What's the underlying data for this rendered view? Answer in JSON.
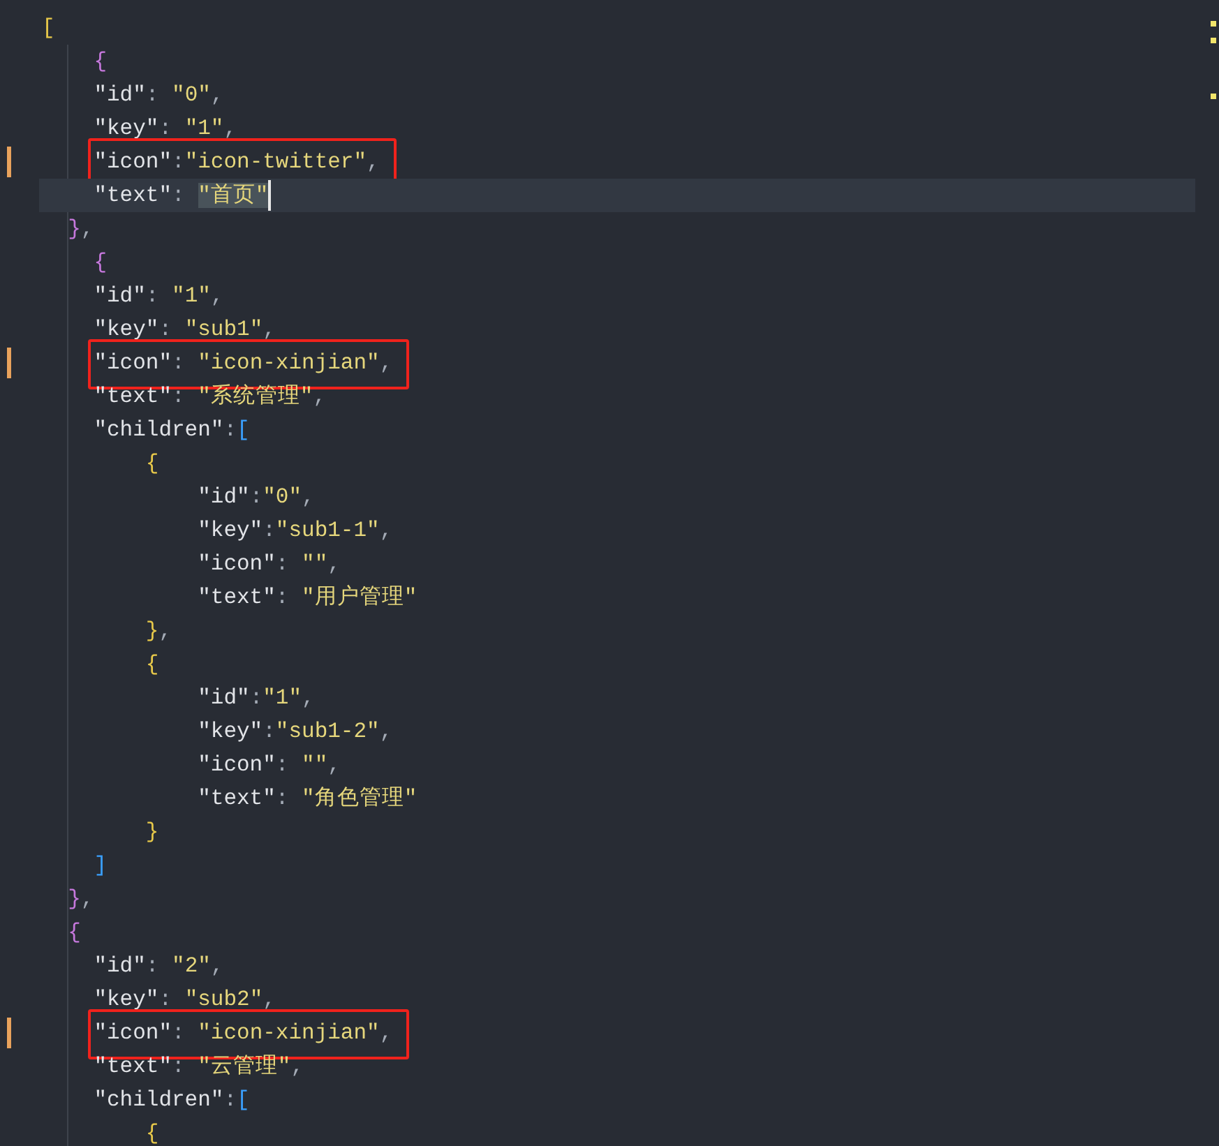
{
  "editor": {
    "lines": [
      {
        "kind": "flush",
        "tokens": [
          {
            "text": "[",
            "kind": "bracket",
            "color": "#e8c94a"
          }
        ]
      },
      {
        "kind": "base",
        "tokens": [
          {
            "text": "{",
            "kind": "bracket",
            "color": "#c678dd"
          }
        ]
      },
      {
        "kind": "base",
        "tokens": [
          {
            "text": "\"id\"",
            "kind": "key"
          },
          {
            "text": ": ",
            "kind": "punct"
          },
          {
            "text": "\"0\"",
            "kind": "string"
          },
          {
            "text": ",",
            "kind": "punct"
          }
        ]
      },
      {
        "kind": "base",
        "tokens": [
          {
            "text": "\"key\"",
            "kind": "key"
          },
          {
            "text": ": ",
            "kind": "punct"
          },
          {
            "text": "\"1\"",
            "kind": "string"
          },
          {
            "text": ",",
            "kind": "punct"
          }
        ]
      },
      {
        "kind": "base",
        "modified": true,
        "annotated": true,
        "tokens": [
          {
            "text": "\"icon\"",
            "kind": "key"
          },
          {
            "text": ":",
            "kind": "punct"
          },
          {
            "text": "\"icon-twitter\"",
            "kind": "string"
          },
          {
            "text": ",",
            "kind": "punct"
          }
        ]
      },
      {
        "kind": "base",
        "current": true,
        "cursor": true,
        "tokens": [
          {
            "text": "\"text\"",
            "kind": "key"
          },
          {
            "text": ": ",
            "kind": "punct"
          },
          {
            "text": "\"首页\"",
            "kind": "string",
            "highlighted": true
          }
        ]
      },
      {
        "kind": "shallow",
        "tokens": [
          {
            "text": "}",
            "kind": "bracket",
            "color": "#c678dd"
          },
          {
            "text": ",",
            "kind": "punct"
          }
        ]
      },
      {
        "kind": "base",
        "tokens": [
          {
            "text": "{",
            "kind": "bracket",
            "color": "#c678dd"
          }
        ]
      },
      {
        "kind": "base",
        "tokens": [
          {
            "text": "\"id\"",
            "kind": "key"
          },
          {
            "text": ": ",
            "kind": "punct"
          },
          {
            "text": "\"1\"",
            "kind": "string"
          },
          {
            "text": ",",
            "kind": "punct"
          }
        ]
      },
      {
        "kind": "base",
        "tokens": [
          {
            "text": "\"key\"",
            "kind": "key"
          },
          {
            "text": ": ",
            "kind": "punct"
          },
          {
            "text": "\"sub1\"",
            "kind": "string"
          },
          {
            "text": ",",
            "kind": "punct"
          }
        ]
      },
      {
        "kind": "base",
        "modified": true,
        "annotated": true,
        "tokens": [
          {
            "text": "\"icon\"",
            "kind": "key"
          },
          {
            "text": ": ",
            "kind": "punct"
          },
          {
            "text": "\"icon-xinjian\"",
            "kind": "string"
          },
          {
            "text": ",",
            "kind": "punct"
          }
        ]
      },
      {
        "kind": "base",
        "tokens": [
          {
            "text": "\"text\"",
            "kind": "key"
          },
          {
            "text": ": ",
            "kind": "punct"
          },
          {
            "text": "\"系统管理\"",
            "kind": "string"
          },
          {
            "text": ",",
            "kind": "punct"
          }
        ]
      },
      {
        "kind": "base",
        "tokens": [
          {
            "text": "\"children\"",
            "kind": "key"
          },
          {
            "text": ":",
            "kind": "punct"
          },
          {
            "text": "[",
            "kind": "bracket",
            "color": "#3aa0ff"
          }
        ]
      },
      {
        "kind": "nested",
        "tokens": [
          {
            "text": "{",
            "kind": "bracket",
            "color": "#e8c94a"
          }
        ]
      },
      {
        "kind": "deep",
        "tokens": [
          {
            "text": "\"id\"",
            "kind": "key"
          },
          {
            "text": ":",
            "kind": "punct"
          },
          {
            "text": "\"0\"",
            "kind": "string"
          },
          {
            "text": ",",
            "kind": "punct"
          }
        ]
      },
      {
        "kind": "deep",
        "tokens": [
          {
            "text": "\"key\"",
            "kind": "key"
          },
          {
            "text": ":",
            "kind": "punct"
          },
          {
            "text": "\"sub1-1\"",
            "kind": "string"
          },
          {
            "text": ",",
            "kind": "punct"
          }
        ]
      },
      {
        "kind": "deep",
        "tokens": [
          {
            "text": "\"icon\"",
            "kind": "key"
          },
          {
            "text": ": ",
            "kind": "punct"
          },
          {
            "text": "\"\"",
            "kind": "string"
          },
          {
            "text": ",",
            "kind": "punct"
          }
        ]
      },
      {
        "kind": "deep",
        "tokens": [
          {
            "text": "\"text\"",
            "kind": "key"
          },
          {
            "text": ": ",
            "kind": "punct"
          },
          {
            "text": "\"用户管理\"",
            "kind": "string"
          }
        ]
      },
      {
        "kind": "nested",
        "tokens": [
          {
            "text": "}",
            "kind": "bracket",
            "color": "#e8c94a"
          },
          {
            "text": ",",
            "kind": "punct"
          }
        ]
      },
      {
        "kind": "nested",
        "tokens": [
          {
            "text": "{",
            "kind": "bracket",
            "color": "#e8c94a"
          }
        ]
      },
      {
        "kind": "deep",
        "tokens": [
          {
            "text": "\"id\"",
            "kind": "key"
          },
          {
            "text": ":",
            "kind": "punct"
          },
          {
            "text": "\"1\"",
            "kind": "string"
          },
          {
            "text": ",",
            "kind": "punct"
          }
        ]
      },
      {
        "kind": "deep",
        "tokens": [
          {
            "text": "\"key\"",
            "kind": "key"
          },
          {
            "text": ":",
            "kind": "punct"
          },
          {
            "text": "\"sub1-2\"",
            "kind": "string"
          },
          {
            "text": ",",
            "kind": "punct"
          }
        ]
      },
      {
        "kind": "deep",
        "tokens": [
          {
            "text": "\"icon\"",
            "kind": "key"
          },
          {
            "text": ": ",
            "kind": "punct"
          },
          {
            "text": "\"\"",
            "kind": "string"
          },
          {
            "text": ",",
            "kind": "punct"
          }
        ]
      },
      {
        "kind": "deep",
        "tokens": [
          {
            "text": "\"text\"",
            "kind": "key"
          },
          {
            "text": ": ",
            "kind": "punct"
          },
          {
            "text": "\"角色管理\"",
            "kind": "string"
          }
        ]
      },
      {
        "kind": "nested",
        "tokens": [
          {
            "text": "}",
            "kind": "bracket",
            "color": "#e8c94a"
          }
        ]
      },
      {
        "kind": "base",
        "tokens": [
          {
            "text": "]",
            "kind": "bracket",
            "color": "#3aa0ff"
          }
        ]
      },
      {
        "kind": "shallow",
        "tokens": [
          {
            "text": "}",
            "kind": "bracket",
            "color": "#c678dd"
          },
          {
            "text": ",",
            "kind": "punct"
          }
        ]
      },
      {
        "kind": "shallow",
        "tokens": [
          {
            "text": "{",
            "kind": "bracket",
            "color": "#c678dd"
          }
        ]
      },
      {
        "kind": "base",
        "tokens": [
          {
            "text": "\"id\"",
            "kind": "key"
          },
          {
            "text": ": ",
            "kind": "punct"
          },
          {
            "text": "\"2\"",
            "kind": "string"
          },
          {
            "text": ",",
            "kind": "punct"
          }
        ]
      },
      {
        "kind": "base",
        "tokens": [
          {
            "text": "\"key\"",
            "kind": "key"
          },
          {
            "text": ": ",
            "kind": "punct"
          },
          {
            "text": "\"sub2\"",
            "kind": "string"
          },
          {
            "text": ",",
            "kind": "punct"
          }
        ]
      },
      {
        "kind": "base",
        "modified": true,
        "annotated": true,
        "tokens": [
          {
            "text": "\"icon\"",
            "kind": "key"
          },
          {
            "text": ": ",
            "kind": "punct"
          },
          {
            "text": "\"icon-xinjian\"",
            "kind": "string"
          },
          {
            "text": ",",
            "kind": "punct"
          }
        ]
      },
      {
        "kind": "base",
        "tokens": [
          {
            "text": "\"text\"",
            "kind": "key"
          },
          {
            "text": ": ",
            "kind": "punct"
          },
          {
            "text": "\"云管理\"",
            "kind": "string"
          },
          {
            "text": ",",
            "kind": "punct"
          }
        ]
      },
      {
        "kind": "base",
        "tokens": [
          {
            "text": "\"children\"",
            "kind": "key"
          },
          {
            "text": ":",
            "kind": "punct"
          },
          {
            "text": "[",
            "kind": "bracket",
            "color": "#3aa0ff"
          }
        ]
      },
      {
        "kind": "nested",
        "tokens": [
          {
            "text": "{",
            "kind": "bracket",
            "color": "#e8c94a"
          }
        ]
      }
    ]
  }
}
